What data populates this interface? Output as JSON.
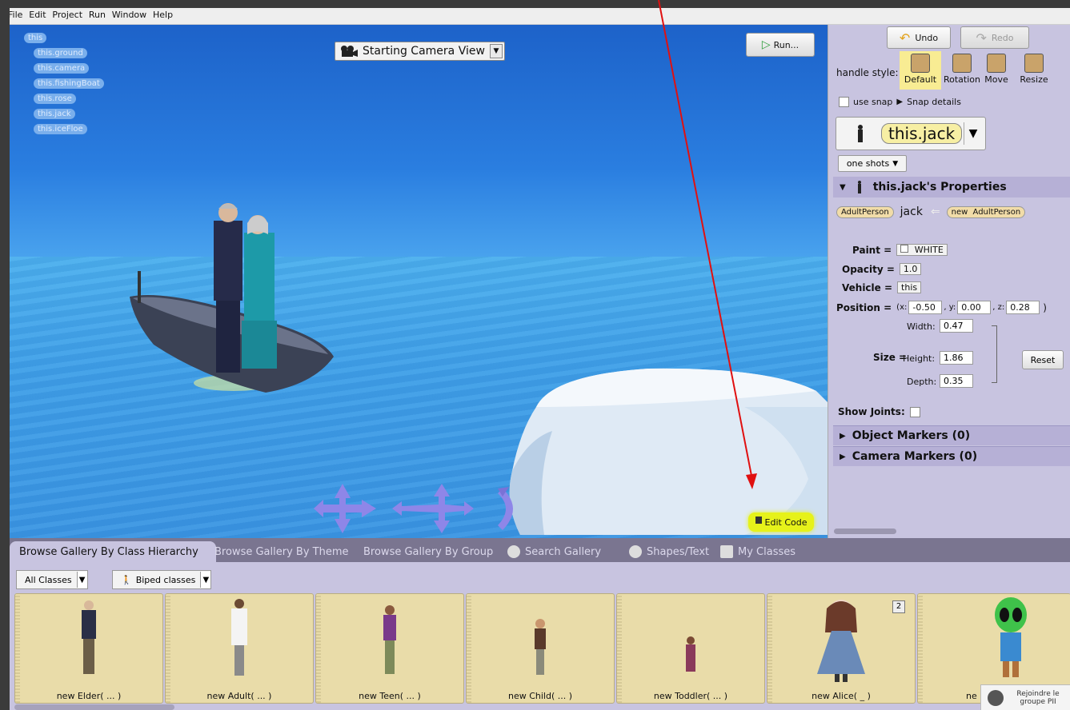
{
  "menu": [
    "File",
    "Edit",
    "Project",
    "Run",
    "Window",
    "Help"
  ],
  "scene": {
    "tree_root": "this",
    "tree_children": [
      "this.ground",
      "this.camera",
      "this.fishingBoat",
      "this.rose",
      "this.jack",
      "this.iceFloe"
    ],
    "camera_view": "Starting Camera View",
    "run_label": "Run...",
    "edit_code_label": "Edit Code"
  },
  "panel": {
    "undo_label": "Undo",
    "redo_label": "Redo",
    "handle_style_label": "handle style:",
    "handle_styles": [
      "Default",
      "Rotation",
      "Move",
      "Resize"
    ],
    "use_snap_label": "use snap",
    "snap_details_label": "Snap details",
    "selected_object": "this.jack",
    "one_shots_label": "one shots",
    "properties_title": "this.jack's Properties",
    "decl_type": "AdultPerson",
    "decl_name": "jack",
    "decl_new": "new",
    "decl_new_type": "AdultPerson",
    "paint_label": "Paint =",
    "paint_value": "WHITE",
    "opacity_label": "Opacity =",
    "opacity_value": "1.0",
    "vehicle_label": "Vehicle =",
    "vehicle_value": "this",
    "position_label": "Position =",
    "position": {
      "x_label": "(x:",
      "x": "-0.50",
      "y_label": ", y:",
      "y": "0.00",
      "z_label": ", z:",
      "z": "0.28",
      "close": ")"
    },
    "size_label": "Size =",
    "width_label": "Width:",
    "width": "0.47",
    "height_label": "Height:",
    "height": "1.86",
    "depth_label": "Depth:",
    "depth": "0.35",
    "reset_label": "Reset",
    "show_joints_label": "Show Joints:",
    "object_markers": "Object Markers (0)",
    "camera_markers": "Camera Markers (0)"
  },
  "gallery": {
    "tabs": [
      "Browse Gallery By Class Hierarchy",
      "Browse Gallery By Theme",
      "Browse Gallery By Group",
      "Search Gallery",
      "Shapes/Text",
      "My Classes"
    ],
    "filter1": "All Classes",
    "filter2": "Biped classes",
    "cards": [
      {
        "label": "new Elder( ... )"
      },
      {
        "label": "new Adult( ... )"
      },
      {
        "label": "new Teen( ... )"
      },
      {
        "label": "new Child( ... )"
      },
      {
        "label": "new Toddler( ... )"
      },
      {
        "label": "new Alice( _ )",
        "badge": "2"
      },
      {
        "label": "ne"
      }
    ],
    "popup_text": "Rejoindre le groupe PII"
  }
}
